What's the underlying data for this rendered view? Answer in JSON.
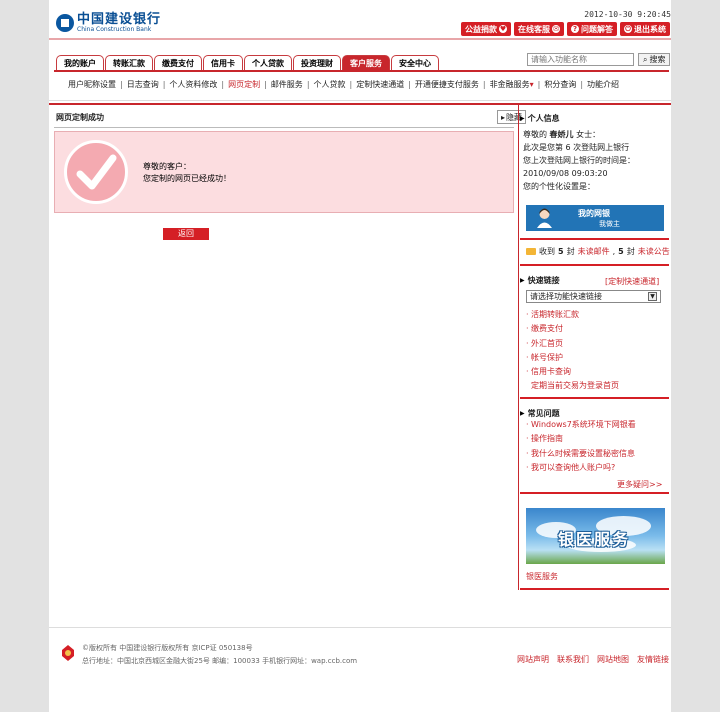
{
  "header": {
    "logo_cn": "中国建设银行",
    "logo_en": "China Construction Bank",
    "datetime": "2012-10-30  9:20:45",
    "top_buttons": [
      {
        "label": "公益捐款",
        "icon": "heart-icon"
      },
      {
        "label": "在线客服",
        "icon": "chat-icon"
      },
      {
        "label": "问题解答",
        "icon": "question-icon"
      },
      {
        "label": "退出系统",
        "icon": "logout-icon"
      }
    ],
    "search_placeholder": "请输入功能名称",
    "search_button": "搜索"
  },
  "tabs": [
    "我的账户",
    "转账汇款",
    "缴费支付",
    "信用卡",
    "个人贷款",
    "投资理财",
    "客户服务",
    "安全中心"
  ],
  "active_tab": 6,
  "subnav": [
    "用户昵称设置",
    "日志查询",
    "个人资料修改",
    "网页定制",
    "邮件服务",
    "个人贷款",
    "定制快速通道",
    "开通便捷支付服务",
    "非金融服务",
    "积分查询",
    "功能介绍"
  ],
  "active_subnav": 3,
  "main": {
    "title": "网页定制成功",
    "hide_button": "隐藏",
    "greeting": "尊敬的客户：",
    "message": "您定制的网页已经成功！",
    "back_button": "返回"
  },
  "sidebar": {
    "info_title": "个人信息",
    "greeting_prefix": "尊敬的",
    "user_name": "春娇儿",
    "user_title": "女士：",
    "login_count_line": "此次是您第 6 次登陆网上银行",
    "last_login_label": "您上次登陆网上银行的时间是：",
    "last_login_time": "2010/09/08   09:03:20",
    "personalization_label": "您的个性化设置是：",
    "banner1_line1": "我的网银",
    "banner1_line2": "我做主",
    "mail_prefix": "收到",
    "mail_count": "5",
    "mail_unit": "封",
    "mail_unread_label": "未读邮件",
    "notice_count": "5",
    "notice_unit": "封",
    "notice_unread_label": "未读公告",
    "quick_title": "快速链接",
    "quick_custom": "[定制快速通道]",
    "quick_select": "请选择功能快速链接",
    "quick_links": [
      "活期转账汇款",
      "缴费支付",
      "外汇首页",
      "帐号保护",
      "信用卡查询",
      "定期当前交易为登录首页"
    ],
    "faq_title": "常见问题",
    "faq_links": [
      "Windows7系统环境下网银看",
      "操作指南",
      "我什么时候需要设置秘密信息",
      "我可以查询他人账户吗?"
    ],
    "faq_more": "更多疑问>>",
    "banner2_text": "银医服务",
    "banner2_caption": "银医服务"
  },
  "footer": {
    "line1": "©版权所有  中国建设银行版权所有  京ICP证 050138号",
    "line2": "总行地址：中国北京西城区金融大街25号  邮编：100033  手机银行网址：wap.ccb.com",
    "links": [
      "网站声明",
      "联系我们",
      "网站地图",
      "友情链接"
    ]
  },
  "colors": {
    "brand_red": "#c8262c",
    "brand_blue": "#0a4f94",
    "success_bg": "#fcdde0"
  }
}
